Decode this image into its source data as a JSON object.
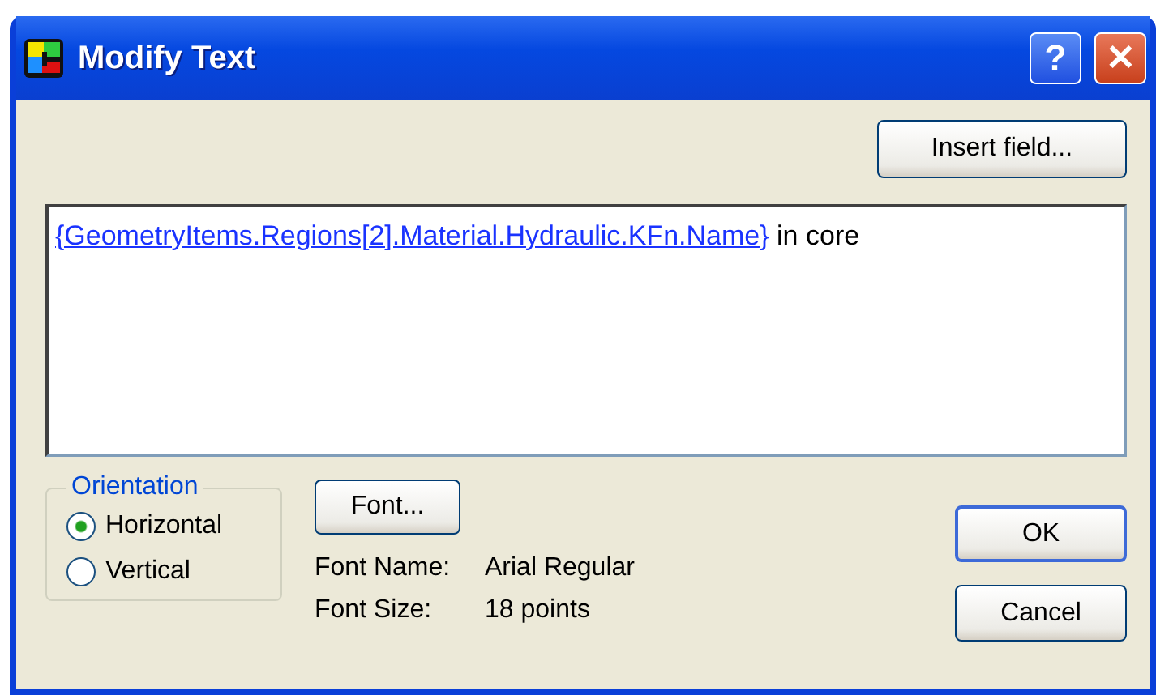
{
  "window": {
    "title": "Modify Text",
    "buttons": [
      {
        "kind": "help",
        "label": "?"
      },
      {
        "kind": "close",
        "label": "✕"
      }
    ]
  },
  "insert_button": "Insert field...",
  "editor": {
    "field": "{GeometryItems.Regions[2].Material.Hydraulic.KFn.Name}",
    "text": "in core"
  },
  "orientation": {
    "title": "Orientation",
    "options": [
      {
        "label": "Horizontal",
        "selected": true
      },
      {
        "label": "Vertical",
        "selected": false
      }
    ]
  },
  "font_button": "Font...",
  "font_info": [
    {
      "label": "Font Name:",
      "value": "Arial Regular"
    },
    {
      "label": "Font Size:",
      "value": "18 points"
    }
  ],
  "buttons": [
    {
      "label": "OK",
      "default": true
    },
    {
      "label": "Cancel",
      "default": false
    }
  ]
}
